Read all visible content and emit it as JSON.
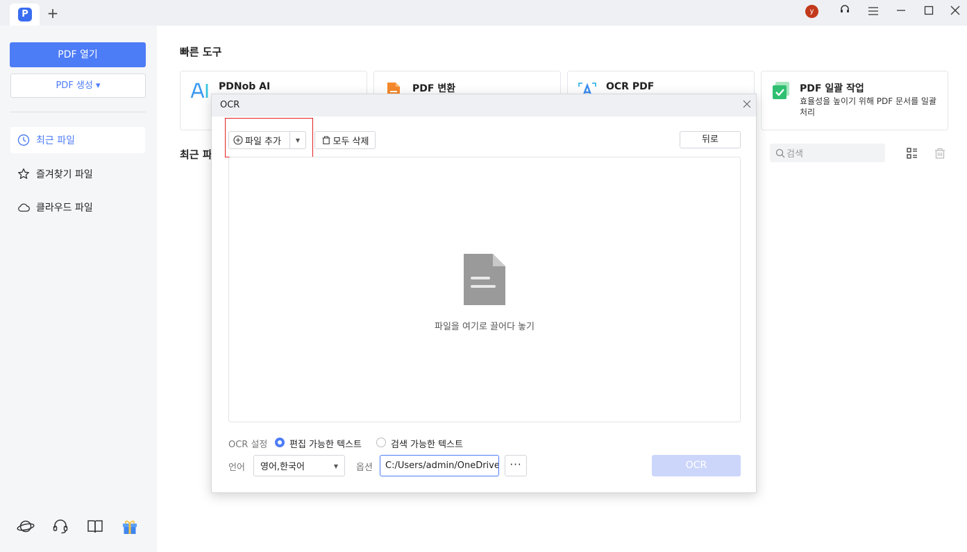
{
  "titlebar": {
    "app_logo": "P",
    "new_tab": "+",
    "avatar": "y"
  },
  "sidebar": {
    "open_pdf": "PDF 열기",
    "create_pdf": "PDF 생성 ▾",
    "items": [
      {
        "label": "최근 파일",
        "icon": "clock-icon"
      },
      {
        "label": "즐겨찾기 파일",
        "icon": "star-icon"
      },
      {
        "label": "클라우드 파일",
        "icon": "cloud-icon"
      }
    ]
  },
  "main": {
    "quick_tools_title": "빠른 도구",
    "recent_files_title": "최근 파",
    "tools": [
      {
        "name": "PDNob AI",
        "desc": ""
      },
      {
        "name": "PDF 변환",
        "desc": ""
      },
      {
        "name": "OCR PDF",
        "desc": ""
      },
      {
        "name": "PDF 일괄 작업",
        "desc": "효율성을 높이기 위해 PDF 문서를 일괄 처리"
      }
    ],
    "search_placeholder": "검색"
  },
  "modal": {
    "title": "OCR",
    "add_file": "파일 추가",
    "delete_all": "모두 삭제",
    "back": "뒤로",
    "drop_text": "파일을 여기로 끌어다 놓기",
    "ocr_setting_label": "OCR 설정",
    "radio_editable": "편집 가능한 텍스트",
    "radio_searchable": "검색 가능한 텍스트",
    "language_label": "언어",
    "language_value": "영어,한국어",
    "option_label": "옵션",
    "output_path": "C:/Users/admin/OneDrive/",
    "more": "···",
    "ocr_button": "OCR"
  },
  "colors": {
    "accent": "#4d7cf7",
    "highlight": "#e02020",
    "disabled_button": "#ccd6fb"
  }
}
